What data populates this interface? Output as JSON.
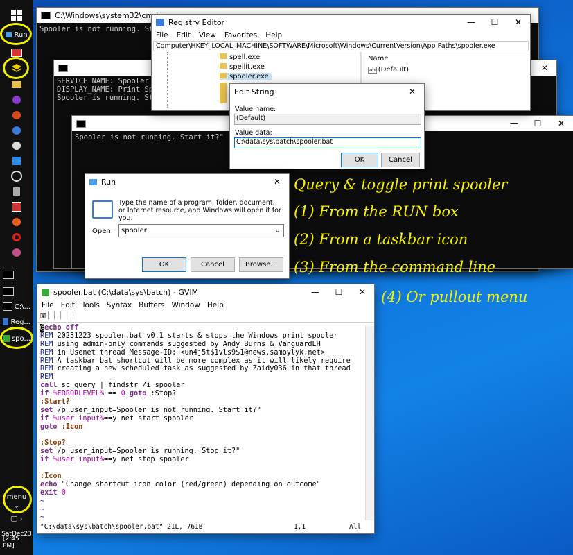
{
  "taskbar": {
    "run_label": "Run",
    "items": [
      "C:\\...",
      "Reg...",
      "spo..."
    ],
    "menu_label": "menu",
    "date": "SatDec23",
    "time": "[2:45 PM]"
  },
  "cmd1": {
    "title": "C:\\Windows\\system32\\cmd.exe",
    "line": "Spooler is not running. Start"
  },
  "cmd2": {
    "lines": [
      "SERVICE_NAME: Spooler",
      "DISPLAY_NAME: Print Spoo",
      "Spooler is running. Stop"
    ]
  },
  "cmd3": {
    "line": "Spooler is not running. Start it?\""
  },
  "regedit": {
    "title": "Registry Editor",
    "menu": [
      "File",
      "Edit",
      "View",
      "Favorites",
      "Help"
    ],
    "path": "Computer\\HKEY_LOCAL_MACHINE\\SOFTWARE\\Microsoft\\Windows\\CurrentVersion\\App Paths\\spooler.exe",
    "tree": [
      "spell.exe",
      "spellit.exe",
      "spooler.exe"
    ],
    "col_name": "Name",
    "value_default": "(Default)"
  },
  "editstring": {
    "title": "Edit String",
    "name_label": "Value name:",
    "name_value": "(Default)",
    "data_label": "Value data:",
    "data_value": "C:\\data\\sys\\batch\\spooler.bat",
    "ok": "OK",
    "cancel": "Cancel"
  },
  "run": {
    "title": "Run",
    "desc": "Type the name of a program, folder, document, or Internet resource, and Windows will open it for you.",
    "open_label": "Open:",
    "input_value": "spooler",
    "ok": "OK",
    "cancel": "Cancel",
    "browse": "Browse..."
  },
  "annotations": [
    "Query & toggle print spooler",
    "(1) From the RUN box",
    "(2) From a taskbar icon",
    "(3) From the command line",
    "(4) Or pullout menu"
  ],
  "gvim": {
    "title": "spooler.bat (C:\\data\\sys\\batch) - GVIM",
    "menu": [
      "File",
      "Edit",
      "Tools",
      "Syntax",
      "Buffers",
      "Window",
      "Help"
    ],
    "status_file": "\"C:\\data\\sys\\batch\\spooler.bat\" 21L, 761B",
    "status_pos": "1,1",
    "status_all": "All"
  },
  "colors": {
    "annotation": "#f5f000",
    "desktop": "#0e6fd6",
    "taskbar": "#111111"
  }
}
